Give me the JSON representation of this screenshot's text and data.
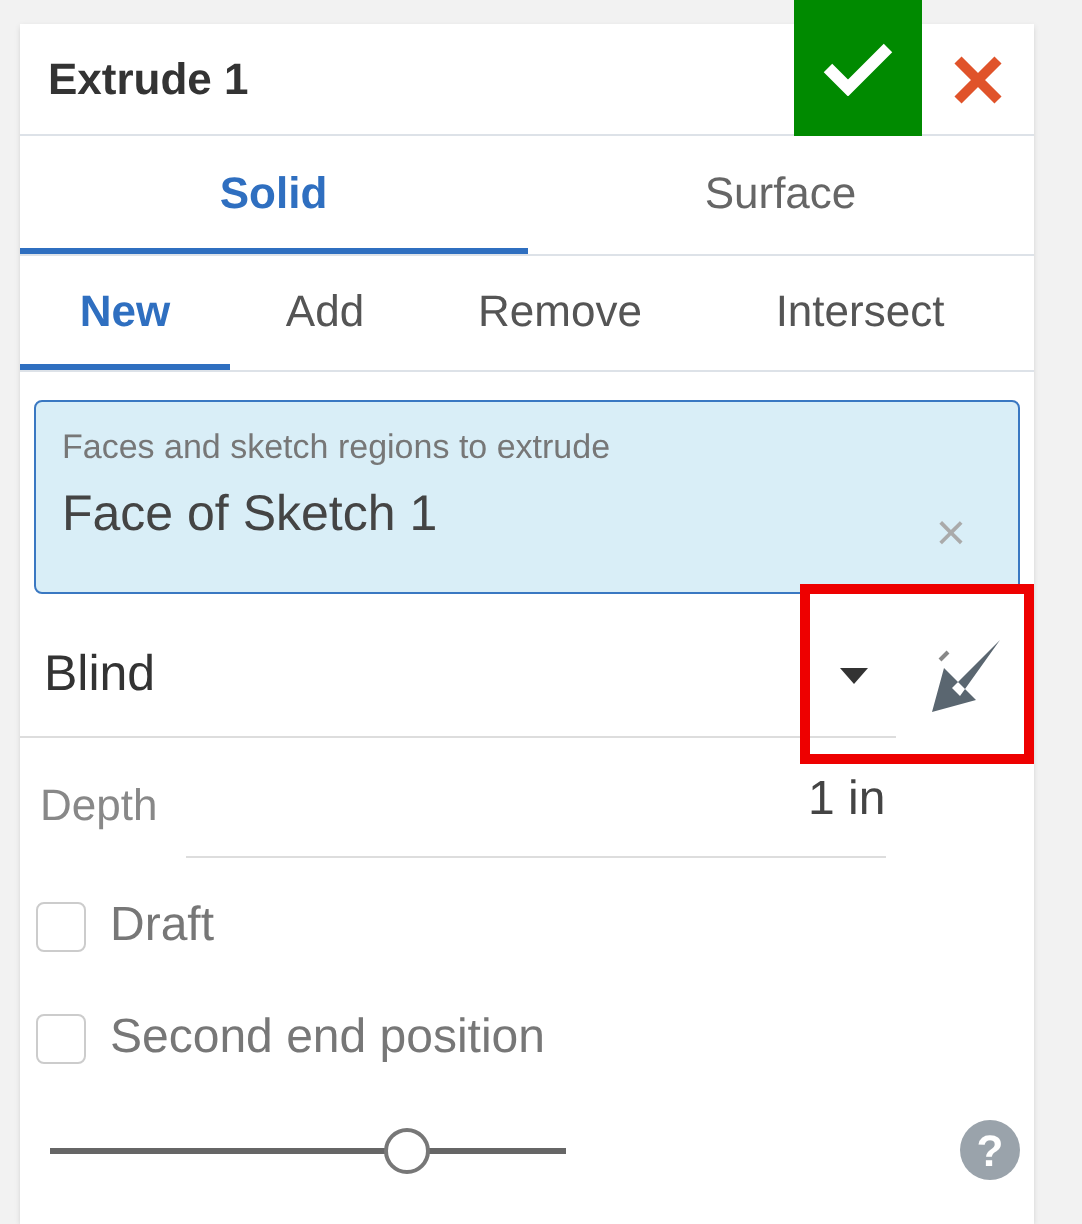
{
  "title": "Extrude 1",
  "tabs": [
    {
      "label": "Solid",
      "selected": true
    },
    {
      "label": "Surface",
      "selected": false
    }
  ],
  "operations": [
    {
      "label": "New",
      "selected": true
    },
    {
      "label": "Add",
      "selected": false
    },
    {
      "label": "Remove",
      "selected": false
    },
    {
      "label": "Intersect",
      "selected": false
    }
  ],
  "selection_field": {
    "label": "Faces and sketch regions to extrude",
    "value": "Face of Sketch 1",
    "clear": "×"
  },
  "end_type": {
    "value": "Blind",
    "highlighted": true
  },
  "depth": {
    "label": "Depth",
    "value": "1 in"
  },
  "options": [
    {
      "label": "Draft",
      "checked": false
    },
    {
      "label": "Second end position",
      "checked": false
    }
  ],
  "slider": {
    "level": 0.69
  },
  "help": "?"
}
